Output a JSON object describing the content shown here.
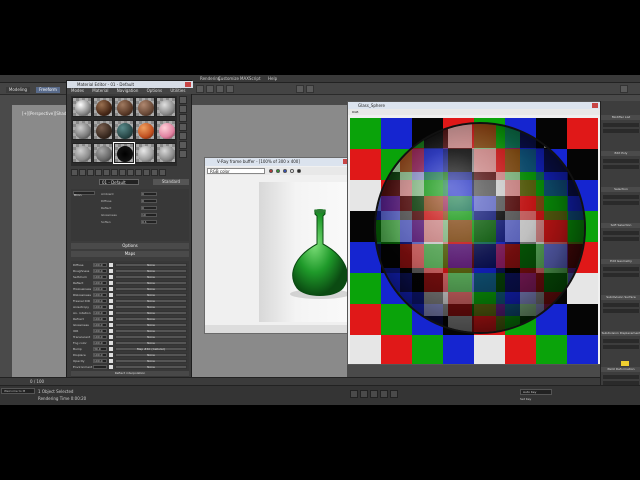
{
  "menubar": {
    "items": [
      "Rendering",
      "Customize",
      "MAXScript",
      "Help"
    ]
  },
  "ribbon": {
    "tab_modeling": "Modeling",
    "tab_freeform": "Freeform"
  },
  "viewport": {
    "label": "[+][Perspective][Shaded + Edged Faces]"
  },
  "material_editor": {
    "title": "Material Editor - 01 - Default",
    "menu": [
      "Modes",
      "Material",
      "Navigation",
      "Options",
      "Utilities"
    ],
    "material_name": "01 - Default",
    "material_type": "Standard",
    "shader": "Blinn",
    "basic_params": [
      {
        "label": "Ambient",
        "value": "0"
      },
      {
        "label": "Diffuse",
        "value": "0"
      },
      {
        "label": "Reflect",
        "value": "0"
      },
      {
        "label": "Glossiness",
        "value": "10"
      },
      {
        "label": "Soften",
        "value": "0.1"
      }
    ],
    "options_header": "Options",
    "maps_header": "Maps",
    "maps": [
      {
        "name": "Diffuse",
        "amount": "100.0",
        "map": "None"
      },
      {
        "name": "Roughness",
        "amount": "100.0",
        "map": "None"
      },
      {
        "name": "Self-illum",
        "amount": "100.0",
        "map": "None"
      },
      {
        "name": "Reflect",
        "amount": "100.0",
        "map": "None"
      },
      {
        "name": "HGlossiness",
        "amount": "100.0",
        "map": "None"
      },
      {
        "name": "RGlossiness",
        "amount": "100.0",
        "map": "None"
      },
      {
        "name": "Fresnel IOR",
        "amount": "100.0",
        "map": "None"
      },
      {
        "name": "Anisotropy",
        "amount": "100.0",
        "map": "None"
      },
      {
        "name": "An. rotation",
        "amount": "100.0",
        "map": "None"
      },
      {
        "name": "Refract",
        "amount": "100.0",
        "map": "None"
      },
      {
        "name": "Glossiness",
        "amount": "100.0",
        "map": "None"
      },
      {
        "name": "IOR",
        "amount": "100.0",
        "map": "None"
      },
      {
        "name": "Translucent",
        "amount": "100.0",
        "map": "None"
      },
      {
        "name": "Fog color",
        "amount": "100.0",
        "map": "None"
      },
      {
        "name": "Bump",
        "amount": "30.0",
        "map": "Map #40 (Cellular)"
      },
      {
        "name": "Displace",
        "amount": "100.0",
        "map": "None"
      },
      {
        "name": "Opacity",
        "amount": "100.0",
        "map": "None"
      },
      {
        "name": "Environment",
        "amount": "",
        "map": "None"
      }
    ],
    "rollouts": [
      "Reflect interpolation",
      "Refract interpolation",
      "mental ray Connection"
    ]
  },
  "vfb": {
    "title": "V-Ray frame buffer - [100% of 300 x 400]",
    "channel": "RGB color",
    "dot_colors": [
      "#c83030",
      "#30a030",
      "#3050c8",
      "#ffffff",
      "#222222"
    ]
  },
  "render_window": {
    "title": "Glass_Sphere",
    "channel": "RGB"
  },
  "command_panel": {
    "rows": [
      "Modifier List",
      "Edit Poly",
      "Selection",
      "Soft Selection",
      "Edit Geometry",
      "Subdivision Surface",
      "Subdivision Displacement",
      "Paint Deformation"
    ],
    "values": [
      "1",
      "0.5",
      "1.0",
      "0.0"
    ]
  },
  "timeline": {
    "frame": "0 / 100"
  },
  "status": {
    "left": "Welcome to M",
    "selected": "1 Object Selected",
    "time": "Rendering Time 0:00:20",
    "autokey": "Auto Key",
    "setkey": "Set Key"
  },
  "colors": {
    "red": "#e01818",
    "green": "#0aa30a",
    "blue": "#1525d0",
    "white": "#e6e6e6",
    "black": "#050505"
  }
}
